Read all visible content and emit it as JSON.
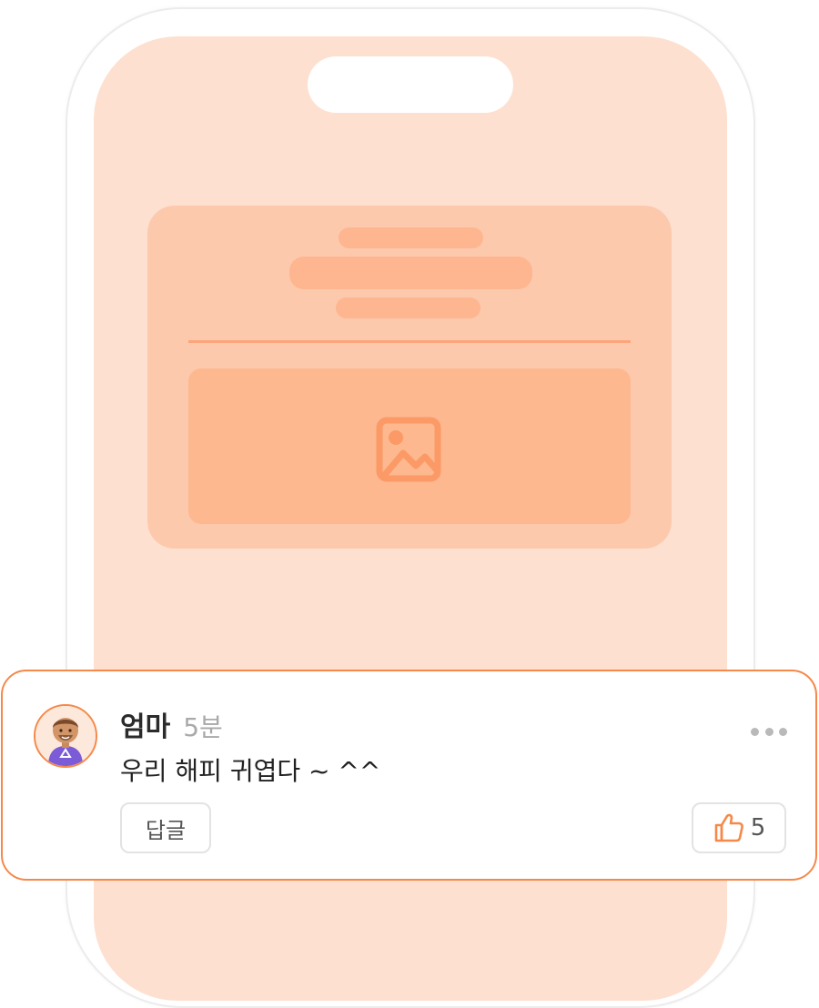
{
  "colors": {
    "accent": "#f5894a",
    "screen_bg": "#fde0d0",
    "skeleton_card": "#fdc9ad",
    "skeleton_bar": "#fdb690"
  },
  "comment": {
    "author": "엄마",
    "time": "5분",
    "text": "우리 해피 귀엽다 ~ ^^",
    "reply_label": "답글",
    "like_count": "5",
    "avatar_icon": "user-avatar",
    "more_icon": "more-horizontal-icon",
    "like_icon": "thumbs-up-icon"
  },
  "skeleton": {
    "image_icon": "image-placeholder-icon"
  }
}
